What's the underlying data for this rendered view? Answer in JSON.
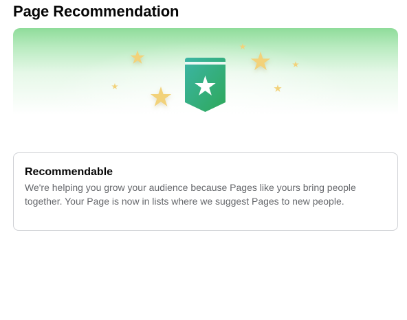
{
  "page": {
    "title": "Page Recommendation"
  },
  "banner": {
    "icon": "recommendation-badge-icon",
    "decorations": "star-icon",
    "colors": {
      "banner_top": "#8fdc9a",
      "badge_left": "#3cb5a5",
      "badge_right": "#2ea85a",
      "star": "#f2d27a"
    }
  },
  "status_card": {
    "title": "Recommendable",
    "description": "We're helping you grow your audience because Pages like yours bring people together. Your Page is now in lists where we suggest Pages to new people."
  },
  "colors": {
    "title_text": "#050505",
    "secondary_text": "#65676b",
    "card_border": "#ced0d4"
  }
}
